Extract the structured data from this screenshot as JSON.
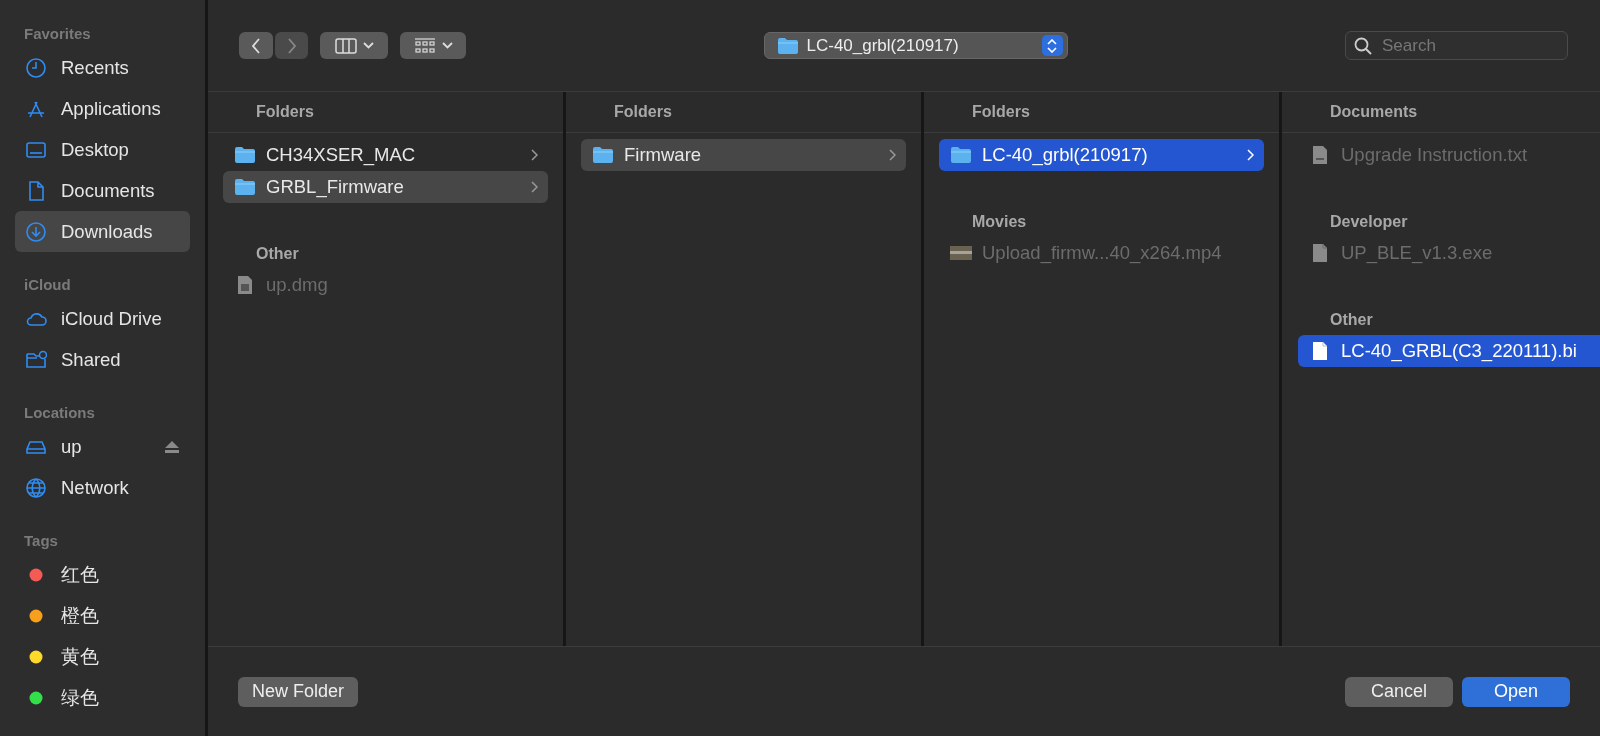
{
  "sidebar": {
    "sections": [
      {
        "heading": "Favorites",
        "items": [
          {
            "label": "Recents",
            "kind": "clock",
            "selected": false
          },
          {
            "label": "Applications",
            "kind": "apps",
            "selected": false
          },
          {
            "label": "Desktop",
            "kind": "desktop",
            "selected": false
          },
          {
            "label": "Documents",
            "kind": "document",
            "selected": false
          },
          {
            "label": "Downloads",
            "kind": "download",
            "selected": true
          }
        ]
      },
      {
        "heading": "iCloud",
        "items": [
          {
            "label": "iCloud Drive",
            "kind": "cloud",
            "selected": false
          },
          {
            "label": "Shared",
            "kind": "shared",
            "selected": false
          }
        ]
      },
      {
        "heading": "Locations",
        "items": [
          {
            "label": "up",
            "kind": "drive",
            "selected": false,
            "ejectable": true
          },
          {
            "label": "Network",
            "kind": "globe",
            "selected": false,
            "ejectable": false
          }
        ]
      },
      {
        "heading": "Tags",
        "items": [
          {
            "label": "红色",
            "kind": "tag",
            "selected": false,
            "color": "#f45b55"
          },
          {
            "label": "橙色",
            "kind": "tag",
            "selected": false,
            "color": "#f8a01c"
          },
          {
            "label": "黄色",
            "kind": "tag",
            "selected": false,
            "color": "#fdd92a"
          },
          {
            "label": "绿色",
            "kind": "tag",
            "selected": false,
            "color": "#33e049"
          }
        ]
      }
    ]
  },
  "toolbar": {
    "path": "LC-40_grbl(210917)",
    "search": {
      "placeholder": "Search"
    }
  },
  "columns": [
    {
      "focused": false,
      "sections": [
        {
          "heading": "Folders",
          "items": [
            {
              "name": "CH34XSER_MAC",
              "kind": "folder",
              "selected": false,
              "disabled": false
            },
            {
              "name": "GRBL_Firmware",
              "kind": "folder",
              "selected": true,
              "disabled": false
            }
          ]
        },
        {
          "heading": "Other",
          "items": [
            {
              "name": "up.dmg",
              "kind": "disk-image",
              "selected": false,
              "disabled": true
            }
          ]
        }
      ]
    },
    {
      "focused": false,
      "sections": [
        {
          "heading": "Folders",
          "items": [
            {
              "name": "Firmware",
              "kind": "folder",
              "selected": true,
              "disabled": false
            }
          ]
        }
      ]
    },
    {
      "focused": true,
      "sections": [
        {
          "heading": "Folders",
          "items": [
            {
              "name": "LC-40_grbl(210917)",
              "kind": "folder",
              "selected": true,
              "disabled": false
            }
          ]
        },
        {
          "heading": "Movies",
          "items": [
            {
              "name": "Upload_firmw...40_x264.mp4",
              "kind": "video",
              "selected": false,
              "disabled": true
            }
          ]
        }
      ]
    },
    {
      "focused": true,
      "sections": [
        {
          "heading": "Documents",
          "items": [
            {
              "name": "Upgrade Instruction.txt",
              "kind": "text-file",
              "selected": false,
              "disabled": true
            }
          ]
        },
        {
          "heading": "Developer",
          "items": [
            {
              "name": "UP_BLE_v1.3.exe",
              "kind": "file",
              "selected": false,
              "disabled": true
            }
          ]
        },
        {
          "heading": "Other",
          "items": [
            {
              "name": "LC-40_GRBL(C3_220111).bi",
              "kind": "file",
              "selected": true,
              "disabled": false
            }
          ]
        }
      ]
    }
  ],
  "footer": {
    "left_buttons": [
      {
        "label": "New Folder",
        "default": false
      }
    ],
    "right_buttons": [
      {
        "label": "Cancel",
        "default": false
      },
      {
        "label": "Open",
        "default": true
      }
    ]
  }
}
